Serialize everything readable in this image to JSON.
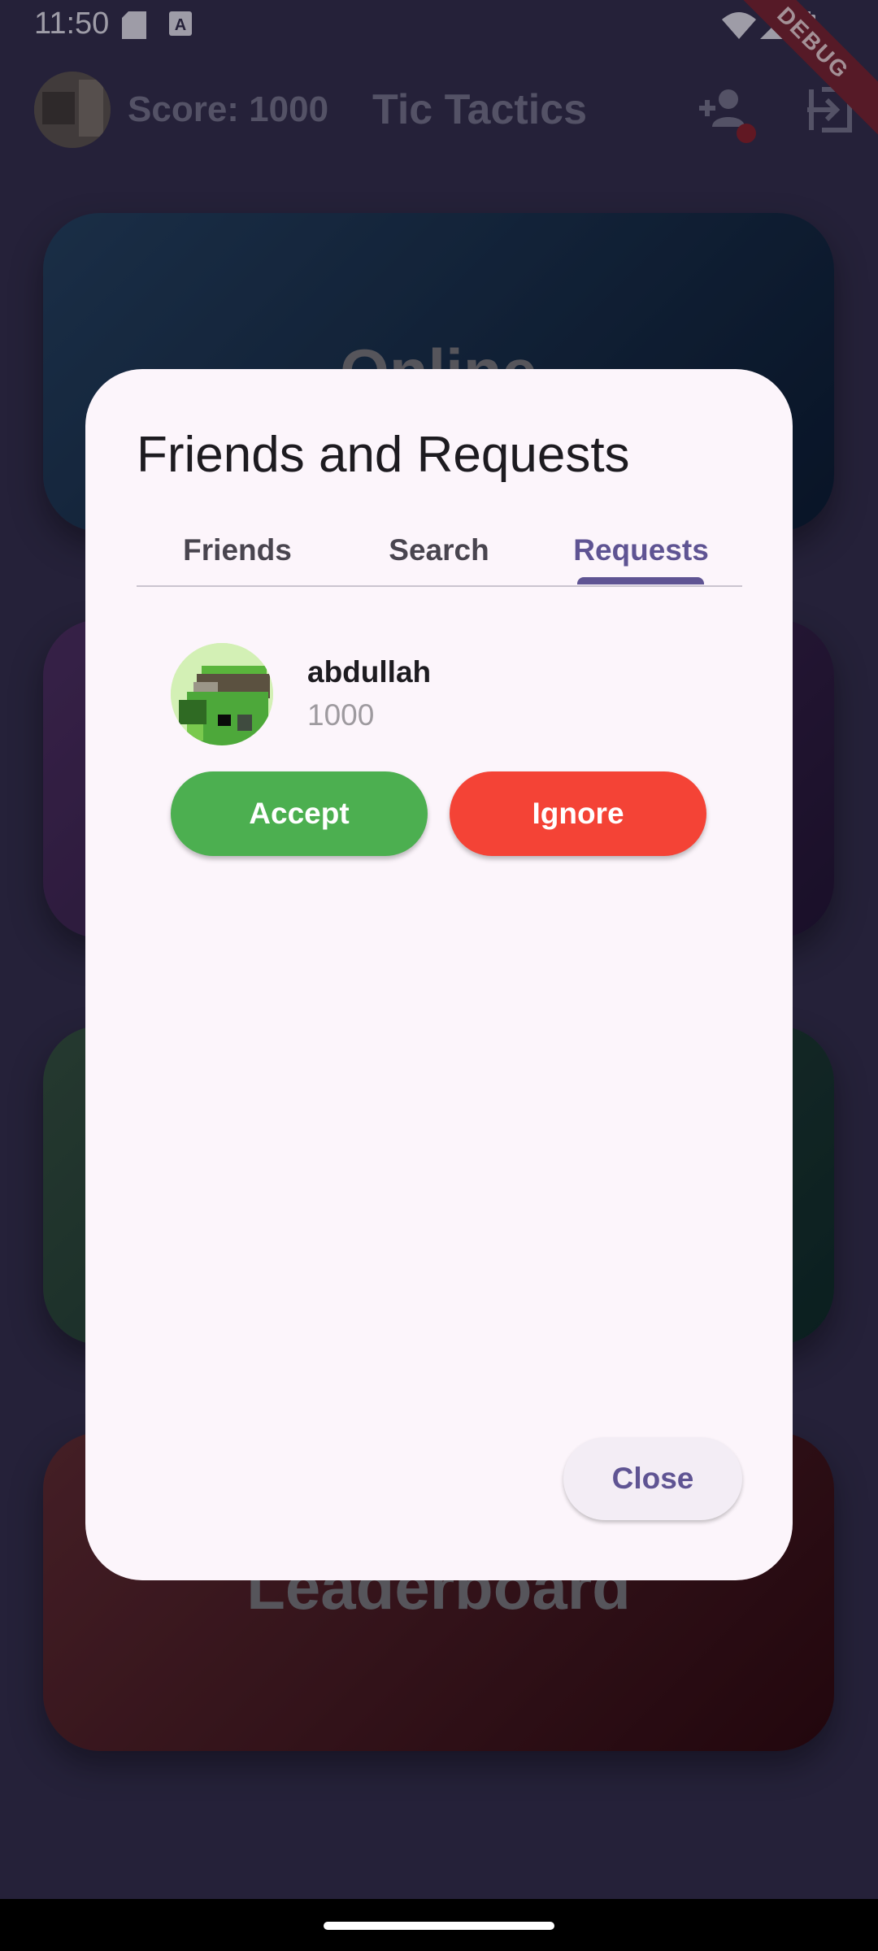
{
  "status_bar": {
    "time": "11:50",
    "debug_label": "DEBUG",
    "icons": [
      "sd-card-icon",
      "a-notification-icon",
      "wifi-icon",
      "signal-icon",
      "battery-icon"
    ]
  },
  "app_bar": {
    "score": "Score: 1000",
    "title": "Tic Tactics",
    "icons": [
      "add-friend-icon",
      "logout-icon"
    ],
    "badge_color": "#8a1c24"
  },
  "background_cards": {
    "online": "Online",
    "leaderboard": "Leaderboard"
  },
  "dialog": {
    "title": "Friends and Requests",
    "tabs": [
      {
        "label": "Friends"
      },
      {
        "label": "Search"
      },
      {
        "label": "Requests"
      }
    ],
    "active_tab": "Requests",
    "requests": [
      {
        "name": "abdullah",
        "score": "1000"
      }
    ],
    "accept_label": "Accept",
    "ignore_label": "Ignore",
    "close_label": "Close"
  },
  "colors": {
    "accent": "#5f5493",
    "accept": "#4caf50",
    "ignore": "#f44336",
    "dialog_bg": "#fcf5fb"
  }
}
